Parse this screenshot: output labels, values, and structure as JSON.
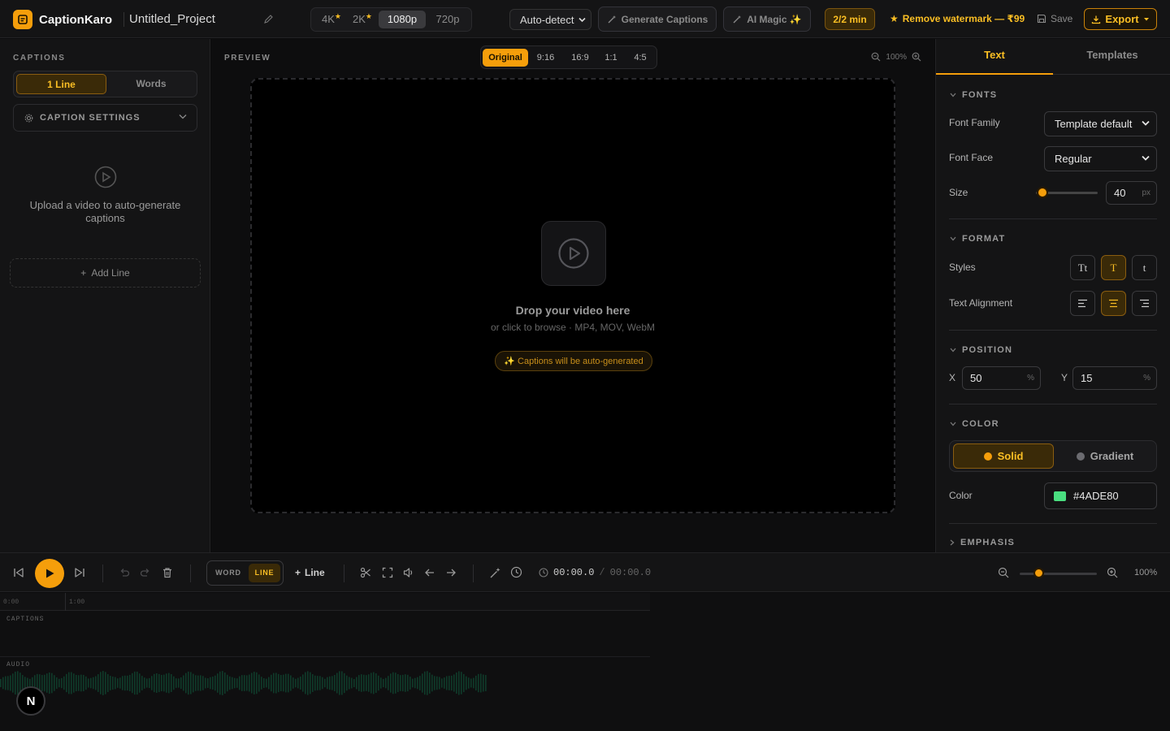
{
  "app": {
    "name": "CaptionKaro",
    "project": "Untitled_Project"
  },
  "header": {
    "resolutions": [
      {
        "label": "4K",
        "premium": true
      },
      {
        "label": "2K",
        "premium": true
      },
      {
        "label": "1080p",
        "premium": false,
        "selected": true
      },
      {
        "label": "720p",
        "premium": false
      }
    ],
    "language_select": "Auto-detect",
    "generate_label": "Generate Captions",
    "ai_magic_label": "AI Magic ✨",
    "usage": "2/2 min",
    "watermark_label": "Remove watermark — ₹99",
    "save_label": "Save",
    "export_label": "Export"
  },
  "captions_panel": {
    "title": "CAPTIONS",
    "modes": [
      "1 Line",
      "Words"
    ],
    "selected_mode": "1 Line",
    "settings_label": "CAPTION SETTINGS",
    "empty_text": "Upload a video to auto-generate captions",
    "add_line_label": "Add Line"
  },
  "preview": {
    "title": "PREVIEW",
    "ratios": [
      "Original",
      "9:16",
      "16:9",
      "1:1",
      "4:5"
    ],
    "selected_ratio": "Original",
    "zoom": "100%",
    "drop_title": "Drop your video here",
    "drop_sub": "or click to browse · MP4, MOV, WebM",
    "autogen_note": "✨ Captions will be auto-generated"
  },
  "properties": {
    "tabs": [
      "Text",
      "Templates"
    ],
    "selected_tab": "Text",
    "fonts": {
      "section": "FONTS",
      "family_label": "Font Family",
      "family_value": "Template default",
      "face_label": "Font Face",
      "face_value": "Regular",
      "size_label": "Size",
      "size_value": "40",
      "size_unit": "px",
      "size_fraction": 0.1
    },
    "format": {
      "section": "FORMAT",
      "styles_label": "Styles",
      "styles": [
        "Tt",
        "T",
        "t"
      ],
      "selected_style": "T",
      "align_label": "Text Alignment",
      "selected_align": "center"
    },
    "position": {
      "section": "POSITION",
      "x_label": "X",
      "x_value": "50",
      "y_label": "Y",
      "y_value": "15",
      "unit": "%"
    },
    "color": {
      "section": "COLOR",
      "modes": [
        "Solid",
        "Gradient"
      ],
      "selected_mode": "Solid",
      "color_label": "Color",
      "value": "#4ADE80"
    },
    "emphasis": {
      "section": "EMPHASIS"
    }
  },
  "toolbar": {
    "mode_word": "WORD",
    "mode_line": "LINE",
    "selected_mode": "LINE",
    "add_line_label": "Line",
    "time_current": "00:00.0",
    "time_separator": "/",
    "time_total": "00:00.0",
    "zoom": "100%",
    "zoom_fraction": 0.25
  },
  "timeline": {
    "ticks": [
      "0:00",
      "1:00"
    ],
    "tracks": [
      "CAPTIONS",
      "AUDIO"
    ]
  },
  "badge": {
    "letter": "N"
  },
  "colors": {
    "accent": "#f59e0b",
    "accent_text": "#fbbf24",
    "waveform": "#0f3b2a",
    "caption_color": "#4ADE80"
  }
}
